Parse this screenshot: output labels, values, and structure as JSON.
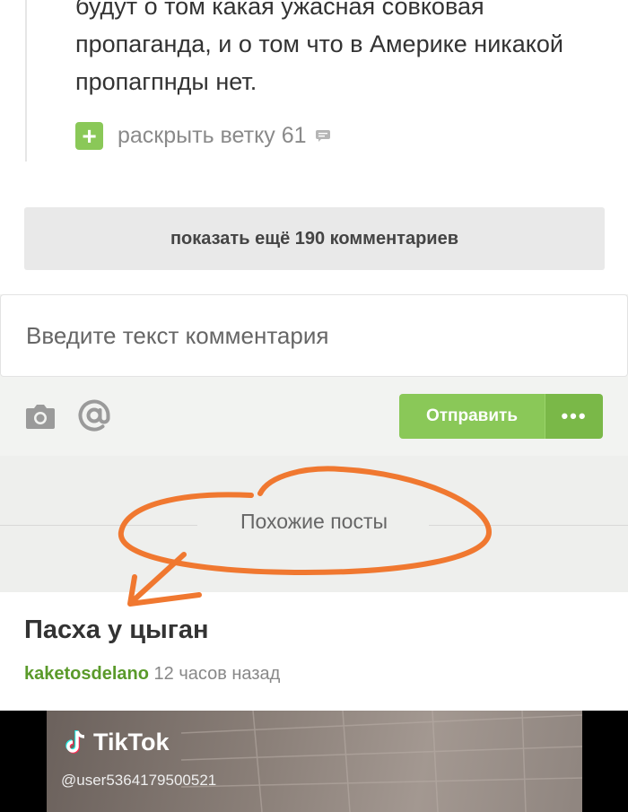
{
  "comment": {
    "lines": [
      "будут о том какая ужасная совковая",
      "пропаганда, и о том что в Америке никакой",
      "пропагпнды нет."
    ],
    "expand_plus": "+",
    "expand_label": "раскрыть ветку 61"
  },
  "show_more_label": "показать ещё 190 комментариев",
  "composer": {
    "placeholder": "Введите текст комментария",
    "send_label": "Отправить",
    "more_label": "•••"
  },
  "similar_posts_title": "Похожие посты",
  "post": {
    "title": "Пасха у цыган",
    "author": "kaketosdelano",
    "time": "12 часов назад",
    "tiktok_brand": "TikTok",
    "tiktok_user": "@user5364179500521"
  },
  "colors": {
    "accent_green": "#8ac858",
    "author_green": "#5a9a2a",
    "annotation_orange": "#f07830"
  }
}
